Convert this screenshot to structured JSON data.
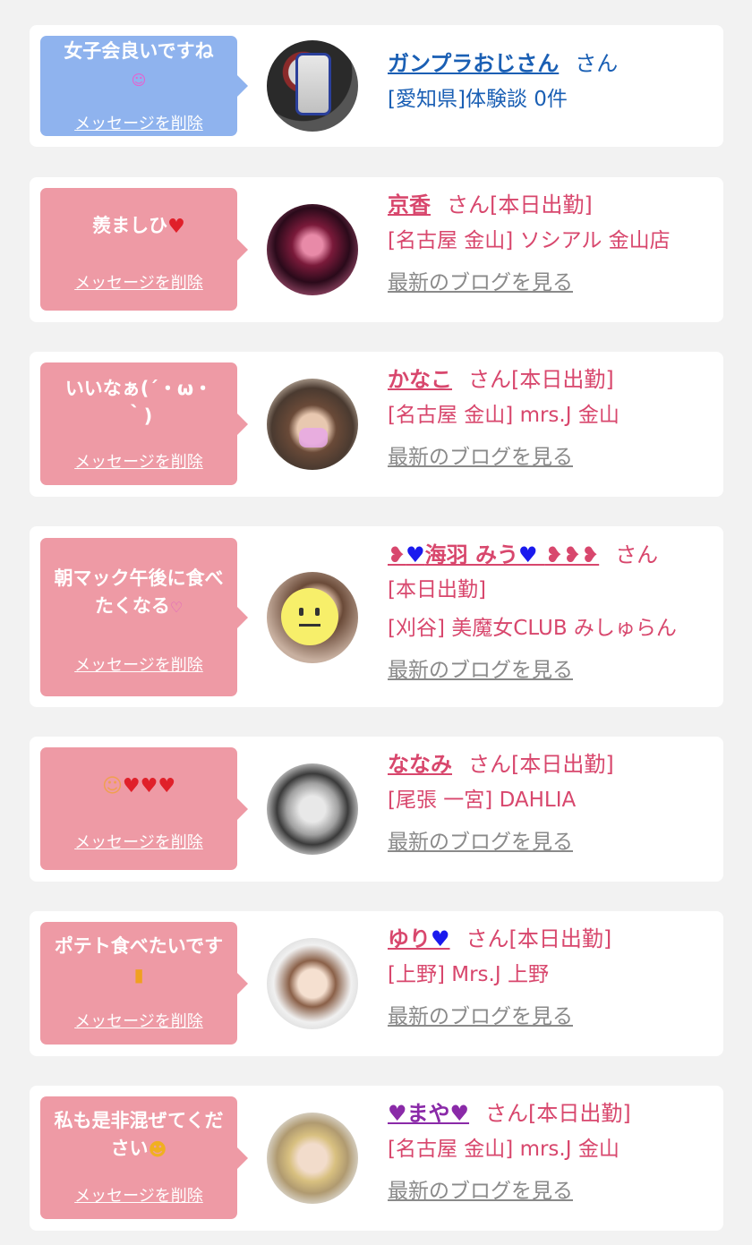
{
  "items": [
    {
      "bubble_color": "#8fb3ee",
      "message": "女子会良いですね",
      "message_icon": "smiling-face-icon",
      "delete_label": "メッセージを削除",
      "name": "ガンプラおじさん",
      "san": "さん",
      "line2": "[愛知県]体験談 0件",
      "blog": "",
      "avatar_icon": "gundam-figure-photo",
      "theme": "blue"
    },
    {
      "bubble_color": "#ee9aa5",
      "message": "羨ましひ",
      "message_icon": "red-heart-icon",
      "delete_label": "メッセージを削除",
      "name": "京香",
      "san": "さん[本日出勤]",
      "line2": "[名古屋 金山] ソシアル 金山店",
      "blog": "最新のブログを見る",
      "avatar_icon": "kimono-photo",
      "theme": "pink"
    },
    {
      "bubble_color": "#ee9aa5",
      "message": "いいなぁ(´・ω・｀)",
      "message_icon": "",
      "delete_label": "メッセージを削除",
      "name": "かなこ",
      "san": "さん[本日出勤]",
      "line2": "[名古屋 金山] mrs.J 金山",
      "blog": "最新のブログを見る",
      "avatar_icon": "portrait-photo",
      "theme": "pink"
    },
    {
      "bubble_color": "#ee9aa5",
      "message": "朝マック午後に食べたくなる",
      "message_icon": "hearts-icon",
      "delete_label": "メッセージを削除",
      "name": "海羽 みう",
      "san": "さん",
      "line2": "[本日出勤]",
      "line3": "[刈谷] 美魔女CLUB みしゅらん",
      "blog": "最新のブログを見る",
      "avatar_icon": "smiley-sticker-photo",
      "theme": "pink"
    },
    {
      "bubble_color": "#ee9aa5",
      "message": "",
      "message_icon": "smile-hearts-icon",
      "delete_label": "メッセージを削除",
      "name": "ななみ",
      "san": "さん[本日出勤]",
      "line2": "[尾張 一宮] DAHLIA",
      "blog": "最新のブログを見る",
      "avatar_icon": "glasses-portrait-photo",
      "theme": "pink"
    },
    {
      "bubble_color": "#ee9aa5",
      "message": "ポテト食べたいです",
      "message_icon": "fries-icon",
      "delete_label": "メッセージを削除",
      "name": "ゆり",
      "san": "さん[本日出勤]",
      "line2": "[上野] Mrs.J 上野",
      "blog": "最新のブログを見る",
      "avatar_icon": "portrait-photo",
      "theme": "pink"
    },
    {
      "bubble_color": "#ee9aa5",
      "message": "私も是非混ぜてください",
      "message_icon": "party-face-icon",
      "delete_label": "メッセージを削除",
      "name": "まや",
      "san": "さん[本日出勤]",
      "line2": "[名古屋 金山] mrs.J 金山",
      "blog": "最新のブログを見る",
      "avatar_icon": "blonde-portrait-photo",
      "theme": "pink"
    }
  ]
}
